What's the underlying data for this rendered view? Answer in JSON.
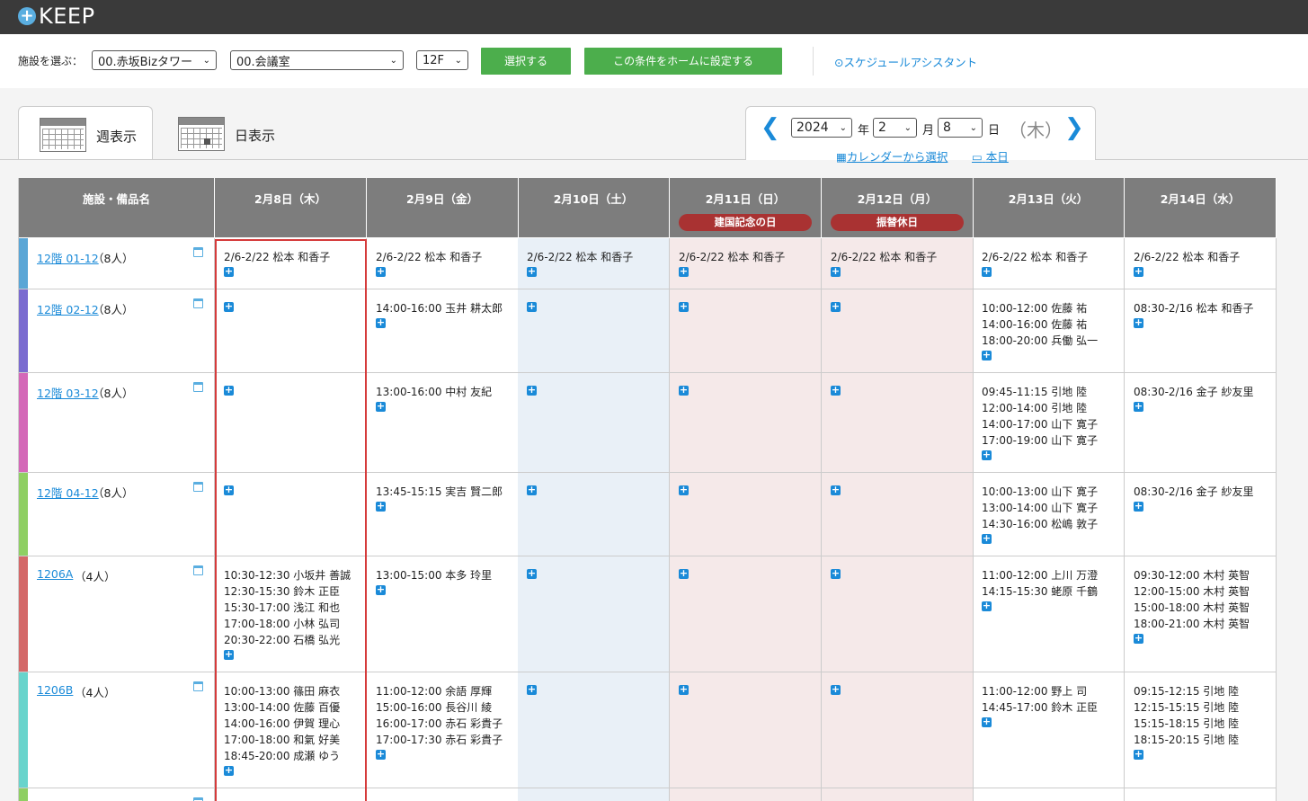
{
  "app": {
    "logo_symbol": "+",
    "logo_text": "KEEP"
  },
  "filters": {
    "label": "施設を選ぶ：",
    "building": "00.赤坂Bizタワー",
    "category": "00.会議室",
    "floor": "12F",
    "select_button": "選択する",
    "home_button": "この条件をホームに設定する",
    "assistant": "スケジュールアシスタント"
  },
  "tabs": {
    "week": "週表示",
    "day": "日表示"
  },
  "date_nav": {
    "year": "2024",
    "year_unit": "年",
    "month": "2",
    "month_unit": "月",
    "day": "8",
    "day_unit": "日",
    "weekday": "（木）",
    "calendar_link": "カレンダーから選択",
    "today_link": "本日"
  },
  "table": {
    "facility_header": "施設・備品名",
    "days": [
      {
        "label": "2月8日（木）",
        "holiday": "",
        "kind": "today"
      },
      {
        "label": "2月9日（金）",
        "holiday": "",
        "kind": "normal"
      },
      {
        "label": "2月10日（土）",
        "holiday": "",
        "kind": "sat"
      },
      {
        "label": "2月11日（日）",
        "holiday": "建国記念の日",
        "kind": "hol"
      },
      {
        "label": "2月12日（月）",
        "holiday": "振替休日",
        "kind": "hol"
      },
      {
        "label": "2月13日（火）",
        "holiday": "",
        "kind": "normal"
      },
      {
        "label": "2月14日（水）",
        "holiday": "",
        "kind": "normal"
      }
    ],
    "rows": [
      {
        "name": "12階 01-12",
        "capacity": "（8人）",
        "color": "#5aa6d6",
        "cells": [
          [
            "2/6-2/22 松本 和香子"
          ],
          [
            "2/6-2/22 松本 和香子"
          ],
          [
            "2/6-2/22 松本 和香子"
          ],
          [
            "2/6-2/22 松本 和香子"
          ],
          [
            "2/6-2/22 松本 和香子"
          ],
          [
            "2/6-2/22 松本 和香子"
          ],
          [
            "2/6-2/22 松本 和香子"
          ]
        ]
      },
      {
        "name": "12階 02-12",
        "capacity": "（8人）",
        "color": "#7a6bd0",
        "cells": [
          [],
          [
            "14:00-16:00 玉井 耕太郎"
          ],
          [],
          [],
          [],
          [
            "10:00-12:00 佐藤 祐",
            "14:00-16:00 佐藤 祐",
            "18:00-20:00 兵働 弘一"
          ],
          [
            "08:30-2/16 松本 和香子"
          ]
        ]
      },
      {
        "name": "12階 03-12",
        "capacity": "（8人）",
        "color": "#d468b8",
        "cells": [
          [],
          [
            "13:00-16:00 中村 友紀"
          ],
          [],
          [],
          [],
          [
            "09:45-11:15 引地 陸",
            "12:00-14:00 引地 陸",
            "14:00-17:00 山下 寛子",
            "17:00-19:00 山下 寛子"
          ],
          [
            "08:30-2/16 金子 紗友里"
          ]
        ]
      },
      {
        "name": "12階 04-12",
        "capacity": "（8人）",
        "color": "#8fcf63",
        "cells": [
          [],
          [
            "13:45-15:15 実吉 賢二郎"
          ],
          [],
          [],
          [],
          [
            "10:00-13:00 山下 寛子",
            "13:00-14:00 山下 寛子",
            "14:30-16:00 松嶋 敦子"
          ],
          [
            "08:30-2/16 金子 紗友里"
          ]
        ]
      },
      {
        "name": "1206A",
        "capacity": "（4人）",
        "color": "#d46868",
        "cells": [
          [
            "10:30-12:30 小坂井 善誠",
            "12:30-15:30 鈴木 正臣",
            "15:30-17:00 浅江 和也",
            "17:00-18:00 小林 弘司",
            "20:30-22:00 石橋 弘光"
          ],
          [
            "13:00-15:00 本多 玲里"
          ],
          [],
          [],
          [],
          [
            "11:00-12:00 上川 万澄",
            "14:15-15:30 蛯原 千鶴"
          ],
          [
            "09:30-12:00 木村 英智",
            "12:00-15:00 木村 英智",
            "15:00-18:00 木村 英智",
            "18:00-21:00 木村 英智"
          ]
        ]
      },
      {
        "name": "1206B",
        "capacity": "（4人）",
        "color": "#68d4cc",
        "cells": [
          [
            "10:00-13:00 篠田 麻衣",
            "13:00-14:00 佐藤 百優",
            "14:00-16:00 伊賀 理心",
            "17:00-18:00 和氣 好美",
            "18:45-20:00 成瀬 ゆう"
          ],
          [
            "11:00-12:00 余語 厚輝",
            "15:00-16:00 長谷川 綾",
            "16:00-17:00 赤石 彩貴子",
            "17:00-17:30 赤石 彩貴子"
          ],
          [],
          [],
          [],
          [
            "11:00-12:00 野上 司",
            "14:45-17:00 鈴木 正臣"
          ],
          [
            "09:15-12:15 引地 陸",
            "12:15-15:15 引地 陸",
            "15:15-18:15 引地 陸",
            "18:15-20:15 引地 陸"
          ]
        ]
      },
      {
        "name": "",
        "capacity": "",
        "color": "#8fcf63",
        "cells": [
          [],
          [],
          [],
          [],
          [],
          [],
          []
        ]
      }
    ]
  }
}
